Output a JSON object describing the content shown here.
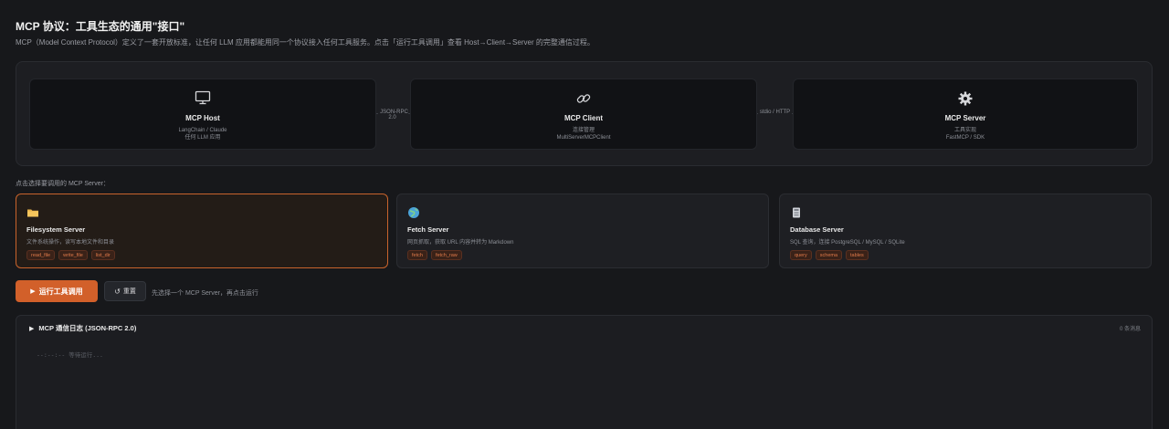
{
  "page": {
    "title": "MCP 协议：工具生态的通用\"接口\"",
    "subtitle": "MCP（Model Context Protocol）定义了一套开放标准，让任何 LLM 应用都能用同一个协议接入任何工具服务。点击「运行工具调用」查看 Host→Client→Server 的完整通信过程。"
  },
  "architecture": {
    "nodes": [
      {
        "title": "MCP Host",
        "sub1": "LangChain / Claude",
        "sub2": "任何 LLM 应用",
        "icon": "monitor-icon"
      },
      {
        "title": "MCP Client",
        "sub1": "连接管理",
        "sub2": "MultiServerMCPClient",
        "icon": "link-icon"
      },
      {
        "title": "MCP Server",
        "sub1": "工具实现",
        "sub2": "FastMCP / SDK",
        "icon": "gear-icon"
      }
    ],
    "links": [
      "JSON-RPC 2.0",
      "stdio / HTTP"
    ]
  },
  "servers": {
    "label": "点击选择要调用的 MCP Server：",
    "items": [
      {
        "name": "Filesystem Server",
        "desc": "文件系统操作，读写本地文件和目录",
        "tags": [
          "read_file",
          "write_file",
          "list_dir"
        ],
        "icon": "folder-icon",
        "selected": true
      },
      {
        "name": "Fetch Server",
        "desc": "网页抓取，获取 URL 内容并转为 Markdown",
        "tags": [
          "fetch",
          "fetch_raw"
        ],
        "icon": "globe-icon",
        "selected": false
      },
      {
        "name": "Database Server",
        "desc": "SQL 查询，连接 PostgreSQL / MySQL / SQLite",
        "tags": [
          "query",
          "schema",
          "tables"
        ],
        "icon": "database-icon",
        "selected": false
      }
    ]
  },
  "controls": {
    "run_label": "运行工具调用",
    "reset_label": "重置",
    "hint": "先选择一个 MCP Server，再点击运行"
  },
  "log": {
    "title": "MCP 通信日志 (JSON-RPC 2.0)",
    "count": "0 条消息",
    "empty": "--:--:--  等待运行..."
  },
  "colors": {
    "accent": "#d2602a",
    "background": "#17181b",
    "tag": "#e07a4a"
  }
}
